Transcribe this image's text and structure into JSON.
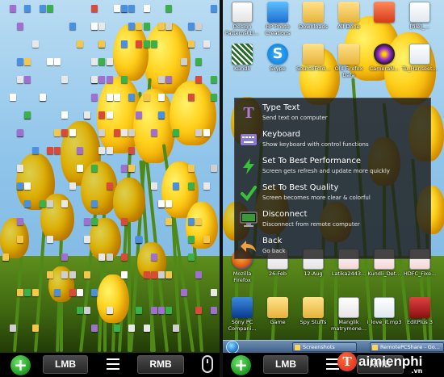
{
  "left_panel": {
    "toolbar": {
      "add_symbol": "+",
      "lmb_label": "LMB",
      "rmb_label": "RMB",
      "menu_icon": "hamburger-icon",
      "mouse_icon": "mouse-icon"
    }
  },
  "right_panel": {
    "desktop_icons": {
      "top_row": [
        "Design Patterns(1)...",
        "HP Photo Creations",
        "Downloads",
        "All Done",
        "",
        "[file]_..."
      ],
      "second_row": [
        "Kundli",
        "Skype",
        "SourceFold...",
        "Old Firefox Data",
        "CameraN...",
        "Tu_Hanseet..."
      ],
      "bottom_row_a": [
        "Mozilla Firefox",
        "26-Feb",
        "12-Aug",
        "Latika2443...",
        "Kundli_Det...",
        "HDFC_Fixe..."
      ],
      "bottom_row_b": [
        "Sony PC Compani...",
        "Game",
        "Spy Stuffs",
        "Manglik matrymone...",
        "i_love_it.mp3",
        "EditPlus 3"
      ]
    },
    "taskbar": {
      "items": [
        "Screenshots",
        "RemotePCShare - Go..."
      ]
    },
    "popup_menu": {
      "items": [
        {
          "title": "Type Text",
          "desc": "Send text on computer",
          "icon": "type-text-icon",
          "color": "#b07ad8"
        },
        {
          "title": "Keyboard",
          "desc": "Show keyboard with control functions",
          "icon": "keyboard-icon",
          "color": "#8a7ad8"
        },
        {
          "title": "Set To Best Performance",
          "desc": "Screen gets refresh and update more quickly",
          "icon": "lightning-icon",
          "color": "#38c23a"
        },
        {
          "title": "Set To Best Quality",
          "desc": "Screen becomes more clear & colorful",
          "icon": "checkmark-icon",
          "color": "#38c23a"
        },
        {
          "title": "Disconnect",
          "desc": "Disconnect from remote computer",
          "icon": "monitor-icon",
          "color": "#3a9a3a"
        },
        {
          "title": "Back",
          "desc": "Go back",
          "icon": "back-arrow-icon",
          "color": "#f0a040"
        }
      ]
    },
    "toolbar": {
      "add_symbol": "+",
      "lmb_label": "LMB",
      "rmb_label": "RMB"
    },
    "watermark": {
      "logo_letter": "T",
      "text": "aimienphi",
      "suffix": ".vn"
    }
  }
}
